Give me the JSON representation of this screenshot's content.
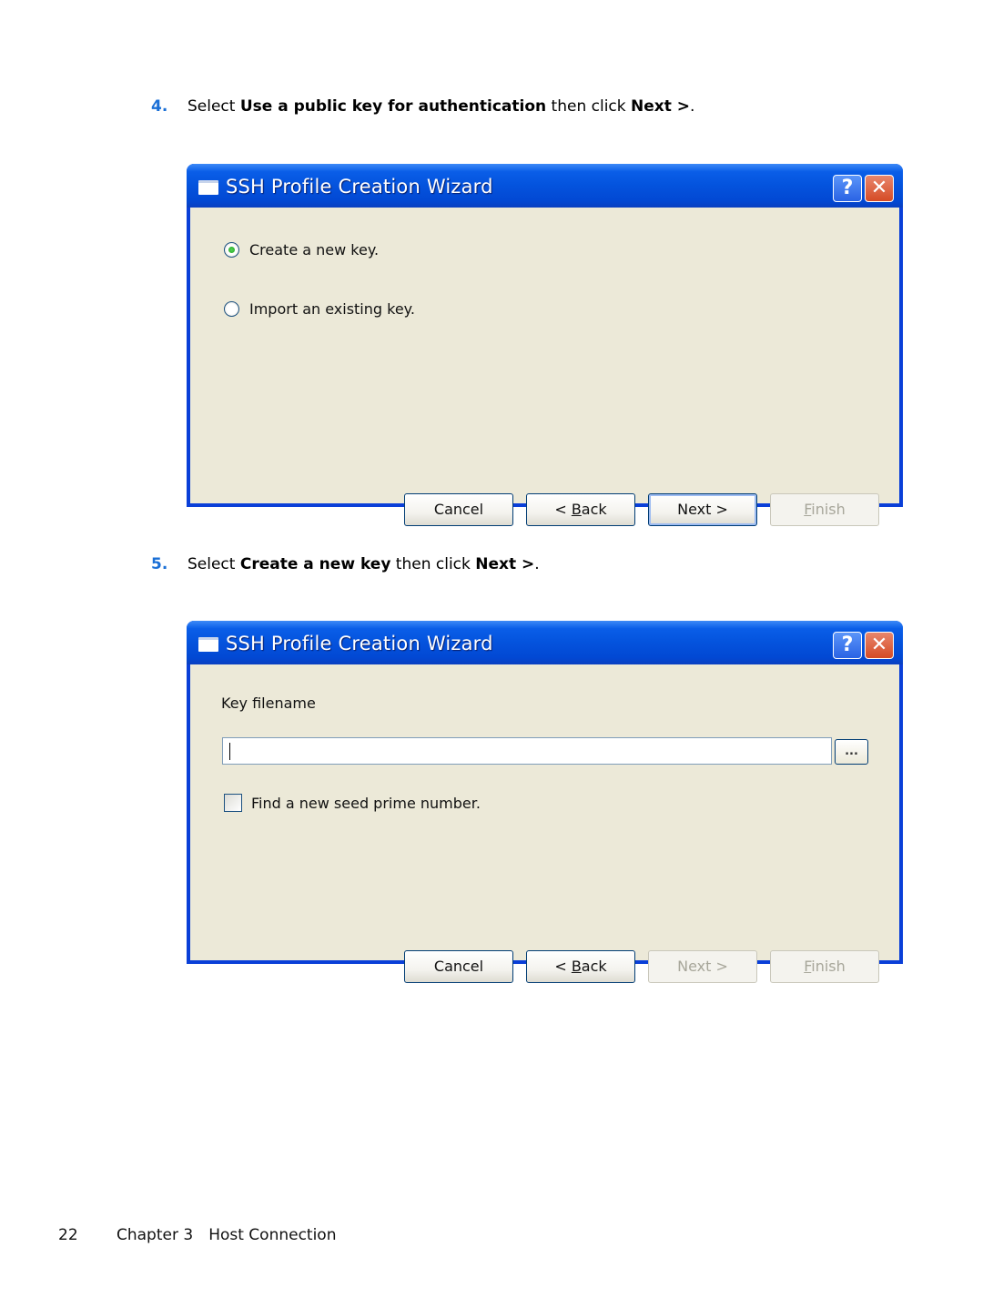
{
  "steps": [
    {
      "number": "4.",
      "prefix": "Select ",
      "bold1": "Use a public key for authentication",
      "middle": " then click ",
      "bold2": "Next >",
      "suffix": "."
    },
    {
      "number": "5.",
      "prefix": "Select ",
      "bold1": "Create a new key",
      "middle": " then click ",
      "bold2": "Next >",
      "suffix": "."
    }
  ],
  "dialogs": [
    {
      "title": "SSH Profile Creation Wizard",
      "help_label": "?",
      "close_label": "✕",
      "options": [
        {
          "label": "Create a new key.",
          "selected": true
        },
        {
          "label": "Import an existing key.",
          "selected": false
        }
      ],
      "buttons": {
        "cancel": "Cancel",
        "back_prefix": "< ",
        "back_mnemonic": "B",
        "back_rest": "ack",
        "next": "Next >",
        "finish_mnemonic": "F",
        "finish_rest": "inish"
      },
      "button_states": {
        "next": "default",
        "finish": "disabled"
      }
    },
    {
      "title": "SSH Profile Creation Wizard",
      "help_label": "?",
      "close_label": "✕",
      "key_filename_label": "Key filename",
      "key_filename_value": "",
      "browse_label": "...",
      "seed_checkbox_label": "Find a new seed prime number.",
      "seed_checked": false,
      "buttons": {
        "cancel": "Cancel",
        "back_prefix": "< ",
        "back_mnemonic": "B",
        "back_rest": "ack",
        "next": "Next >",
        "finish_mnemonic": "F",
        "finish_rest": "inish"
      },
      "button_states": {
        "next": "disabled",
        "finish": "disabled"
      }
    }
  ],
  "footer": {
    "page_number": "22",
    "chapter": "Chapter 3",
    "section": "Host Connection"
  },
  "colors": {
    "step_number": "#1a6fd6",
    "titlebar": "#0453dd",
    "dialog_background": "#ece9d8",
    "close_button": "#d54b25"
  }
}
